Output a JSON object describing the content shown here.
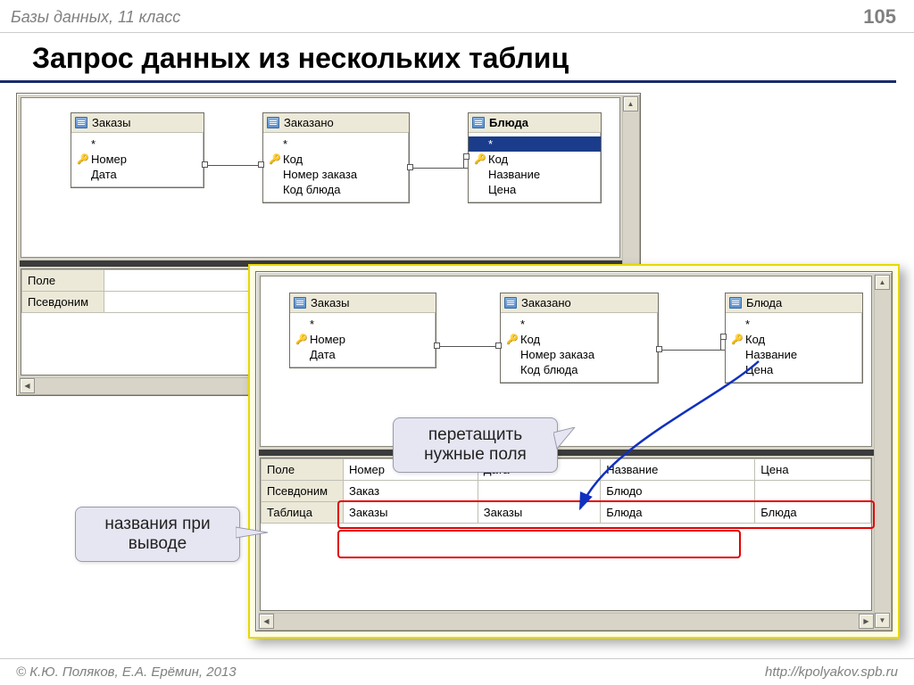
{
  "header": {
    "breadcrumb": "Базы данных, 11 класс",
    "page": "105"
  },
  "title": "Запрос данных из нескольких таблиц",
  "footer": {
    "left": "© К.Ю. Поляков, Е.А. Ерёмин, 2013",
    "right": "http://kpolyakov.spb.ru"
  },
  "back_pane": {
    "tables": {
      "orders": {
        "title": "Заказы",
        "star": "*",
        "key": "Номер",
        "rows": [
          "Дата"
        ]
      },
      "ordered": {
        "title": "Заказано",
        "star": "*",
        "key": "Код",
        "rows": [
          "Номер заказа",
          "Код блюда"
        ]
      },
      "dishes": {
        "title": "Блюда",
        "star": "*",
        "key": "Код",
        "rows": [
          "Название",
          "Цена"
        ],
        "selected_star": true
      }
    },
    "grid": {
      "row_labels": [
        "Поле",
        "Псевдоним"
      ]
    }
  },
  "front_pane": {
    "tables": {
      "orders": {
        "title": "Заказы",
        "star": "*",
        "key": "Номер",
        "rows": [
          "Дата"
        ]
      },
      "ordered": {
        "title": "Заказано",
        "star": "*",
        "key": "Код",
        "rows": [
          "Номер заказа",
          "Код блюда"
        ]
      },
      "dishes": {
        "title": "Блюда",
        "star": "*",
        "key": "Код",
        "rows": [
          "Название",
          "Цена"
        ]
      }
    },
    "grid": {
      "row_labels": [
        "Поле",
        "Псевдоним",
        "Таблица"
      ],
      "cols": [
        {
          "field": "Номер",
          "alias": "Заказ",
          "table": "Заказы"
        },
        {
          "field": "Дата",
          "alias": "",
          "table": "Заказы"
        },
        {
          "field": "Название",
          "alias": "Блюдо",
          "table": "Блюда"
        },
        {
          "field": "Цена",
          "alias": "",
          "table": "Блюда"
        }
      ]
    }
  },
  "callouts": {
    "drag": "перетащить нужные поля",
    "names": "названия при выводе"
  }
}
